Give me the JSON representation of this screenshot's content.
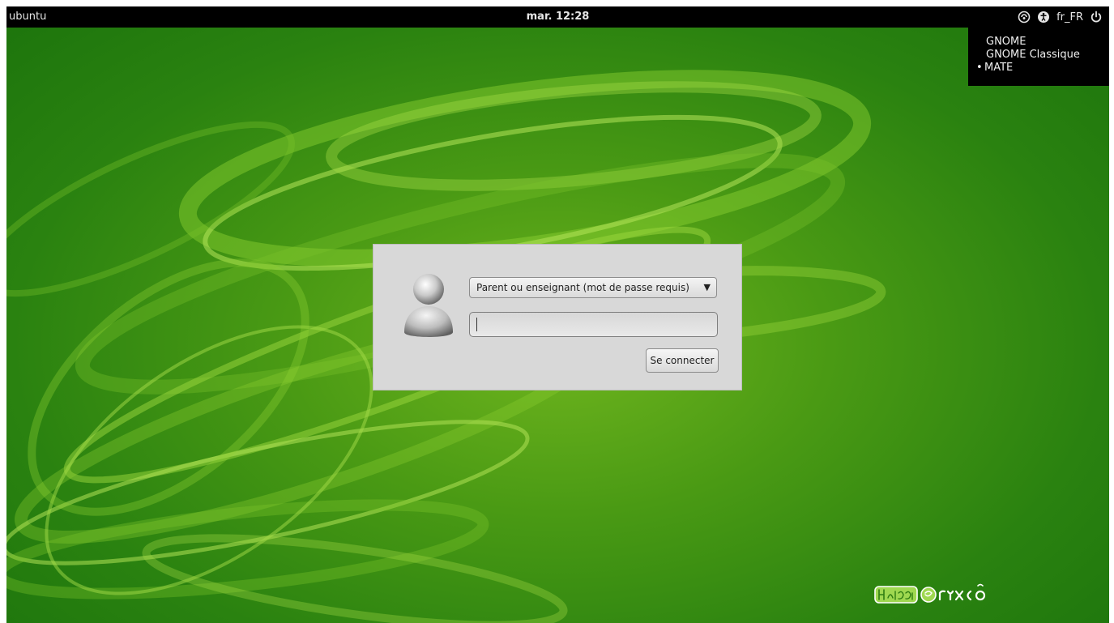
{
  "top_panel": {
    "hostname": "ubuntu",
    "clock": "mar. 12:28",
    "language": "fr_FR",
    "icons": [
      "network-icon",
      "accessibility-icon",
      "power-icon"
    ]
  },
  "session_menu": {
    "items": [
      {
        "label": "GNOME",
        "selected": false
      },
      {
        "label": "GNOME Classique",
        "selected": false
      },
      {
        "label": "MATE",
        "selected": true
      }
    ],
    "bullet": "•"
  },
  "login_dialog": {
    "user_select_value": "Parent ou enseignant (mot de passe requis)",
    "dropdown_arrow": "▼",
    "password_value": "",
    "connect_label": "Se connecter"
  },
  "branding": {
    "logo_text": "abuledu ryxeo"
  },
  "colors": {
    "panel_bg": "#000000",
    "dialog_bg": "#d8d8d8",
    "wallpaper_green": "#2a8210"
  }
}
